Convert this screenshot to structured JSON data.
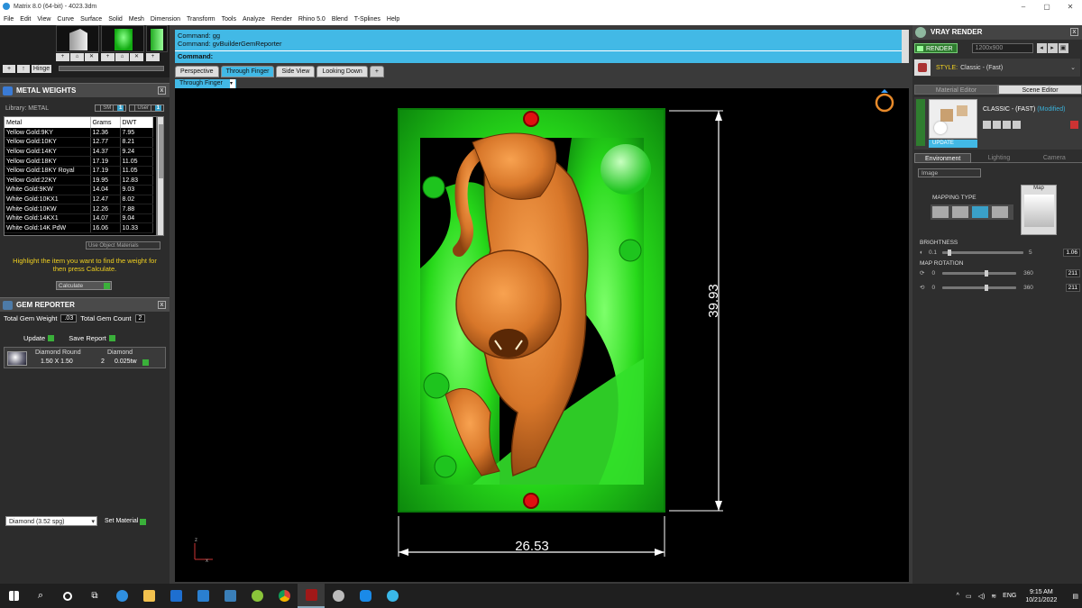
{
  "window": {
    "title": "Matrix 8.0 (64-bit) - 4023.3dm",
    "controls": [
      "–",
      "▢",
      "✕"
    ]
  },
  "menu": [
    "File",
    "Edit",
    "View",
    "Curve",
    "Surface",
    "Solid",
    "Mesh",
    "Dimension",
    "Transform",
    "Tools",
    "Analyze",
    "Render",
    "Rhino 5.0",
    "Blend",
    "T-Splines",
    "Help"
  ],
  "thumbs": {
    "buttons": [
      "+",
      "⌂",
      "✕",
      "+"
    ],
    "nav": [
      "+",
      "↑"
    ],
    "hinge_label": "Hinge"
  },
  "metal_weights": {
    "title": "METAL WEIGHTS",
    "library_label": "Library: METAL",
    "toggle_sm": "SM",
    "toggle_user": "User",
    "toggle_value": "1",
    "columns": [
      "Metal",
      "Grams",
      "DWT"
    ],
    "rows": [
      [
        "Yellow Gold:9KY",
        "12.36",
        "7.95"
      ],
      [
        "Yellow Gold:10KY",
        "12.77",
        "8.21"
      ],
      [
        "Yellow Gold:14KY",
        "14.37",
        "9.24"
      ],
      [
        "Yellow Gold:18KY",
        "17.19",
        "11.05"
      ],
      [
        "Yellow Gold:18KY Royal",
        "17.19",
        "11.05"
      ],
      [
        "Yellow Gold:22KY",
        "19.95",
        "12.83"
      ],
      [
        "White Gold:9KW",
        "14.04",
        "9.03"
      ],
      [
        "White Gold:10KX1",
        "12.47",
        "8.02"
      ],
      [
        "White Gold:10KW",
        "12.26",
        "7.88"
      ],
      [
        "White Gold:14KX1",
        "14.07",
        "9.04"
      ],
      [
        "White Gold:14K PdW",
        "16.06",
        "10.33"
      ]
    ],
    "use_object_materials": "Use Object Materials",
    "hint": "Highlight the item you want to find the weight for then press Calculate.",
    "calculate": "Calculate"
  },
  "gem_reporter": {
    "title": "GEM REPORTER",
    "total_weight_label": "Total Gem Weight",
    "total_weight": ".03",
    "total_count_label": "Total Gem Count",
    "total_count": "2",
    "update": "Update",
    "save_report": "Save Report",
    "gem_col1": "Diamond Round",
    "gem_col2": "Diamond",
    "gem_size": "1.50 X 1.50",
    "gem_qty": "2",
    "gem_wt": "0.025tw"
  },
  "material_select": {
    "value": "Diamond    (3.52 spg)",
    "set_material": "Set Material"
  },
  "command": {
    "line1": "Command: gg",
    "line2": "Command: gvBuilderGemReporter",
    "prompt": "Command:"
  },
  "viewport_tabs": [
    "Perspective",
    "Through Finger",
    "Side View",
    "Looking Down",
    "+"
  ],
  "active_viewport": "Through Finger",
  "dimensions": {
    "height": "39.93",
    "width": "26.53"
  },
  "axis": {
    "z": "z",
    "x": "x"
  },
  "vray": {
    "title": "VRAY RENDER",
    "render": "RENDER",
    "resolution": "1200x900",
    "style_label": "STYLE:",
    "style_value": "Classic - (Fast)",
    "tab_material": "Material Editor",
    "tab_scene": "Scene Editor",
    "scene_name": "CLASSIC - (FAST)",
    "scene_modified": "(Modified)",
    "update": "UPDATE",
    "env_tabs": [
      "Environment",
      "Lighting",
      "Camera"
    ],
    "image_select": "Image",
    "mapping_type": "MAPPING TYPE",
    "map_label": "Map",
    "brightness_label": "BRIGHTNESS",
    "brightness_min": "0.1",
    "brightness_max": "5",
    "brightness_value": "1.06",
    "map_rotation_label": "MAP ROTATION",
    "rot_min": "0",
    "rot_max": "360",
    "rot1": "211",
    "rot2": "211"
  },
  "tray": {
    "lang": "ENG",
    "time": "9:15 AM",
    "date": "10/21/2022"
  },
  "colors": {
    "accent_blue": "#42b9e6",
    "model_green": "#2ee81e",
    "tiger_orange": "#d8772a",
    "hint_yellow": "#f0d020"
  }
}
